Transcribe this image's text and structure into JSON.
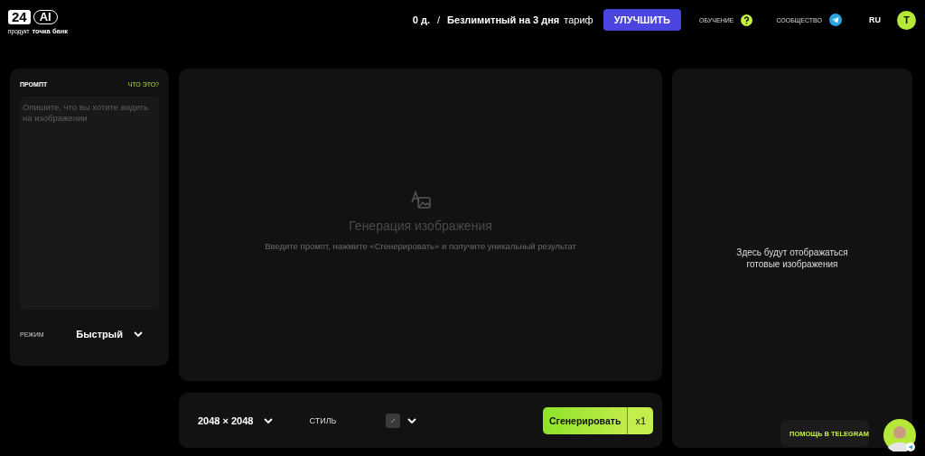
{
  "header": {
    "logo": {
      "number": "24",
      "ai": "AI",
      "subtitle_small": "продукт",
      "subtitle_bank": "точка банк"
    },
    "balance": "0 д.",
    "separator": "/",
    "plan": "Безлимитный на 3 дня",
    "plan_suffix": "тариф",
    "upgrade_button": "УЛУЧШИТЬ",
    "links": [
      {
        "label": "ОБУЧЕНИЕ",
        "kind": "help"
      },
      {
        "label": "СООБЩЕСТВО",
        "kind": "telegram"
      }
    ],
    "language": "RU",
    "avatar": "T"
  },
  "prompt_panel": {
    "title": "ПРОМПТ",
    "help_link": "ЧТО ЭТО?",
    "placeholder": "Опишите, что вы хотите видеть на изображении",
    "mode_label": "РЕЖИМ",
    "mode_value": "Быстрый"
  },
  "canvas": {
    "title": "Генерация изображения",
    "hint": "Введите промпт, нажмите «Сгенерировать» и получите уникальный результат"
  },
  "toolbar": {
    "size": "2048 × 2048",
    "style_label": "СТИЛЬ",
    "generate_button": "Сгенерировать",
    "count": "x1"
  },
  "results_panel": {
    "empty_text": "Здесь будут отображаться готовые изображения"
  },
  "help_chat": {
    "label": "ПОМОЩЬ В TELEGRAM"
  }
}
